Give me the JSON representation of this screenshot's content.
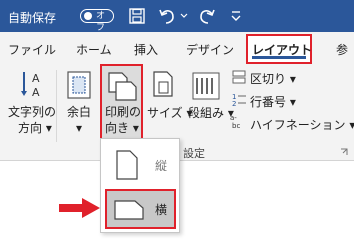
{
  "titlebar": {
    "autosave_label": "自動保存",
    "autosave_state": "オフ"
  },
  "tabs": [
    {
      "label": "ファイル"
    },
    {
      "label": "ホーム"
    },
    {
      "label": "挿入"
    },
    {
      "label": "デザイン"
    },
    {
      "label": "レイアウト",
      "active": true
    },
    {
      "label": "参"
    }
  ],
  "ribbon": {
    "text_direction": {
      "line1": "文字列の",
      "line2": "方向 ▾"
    },
    "margins": {
      "line1": "余白",
      "line2": "▾"
    },
    "orientation": {
      "line1": "印刷の",
      "line2": "向き ▾"
    },
    "size": {
      "label": "サイズ ▾"
    },
    "columns": {
      "label": "段組み ▾"
    },
    "breaks": {
      "label": "区切り ▾"
    },
    "line_numbers": {
      "label": "行番号 ▾"
    },
    "hyphenation": {
      "label": "ハイフネーション ▾"
    },
    "group_label_fragment": "設定"
  },
  "orientation_menu": {
    "portrait": "縦",
    "landscape": "横"
  },
  "colors": {
    "titlebar": "#2b579a",
    "highlight": "#e0212b",
    "arrow": "#e0212b"
  }
}
